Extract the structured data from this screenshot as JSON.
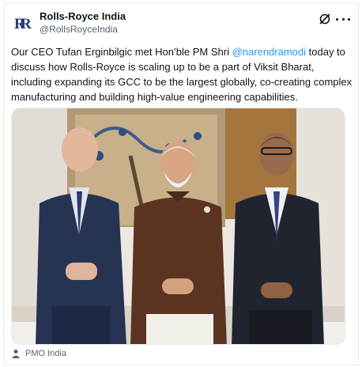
{
  "account": {
    "name": "Rolls-Royce India",
    "handle": "@RollsRoyceIndia"
  },
  "tweet": {
    "text_before": "Our CEO Tufan Erginbilgic met Hon’ble PM Shri ",
    "mention": "@narendramodi",
    "text_after": " today to discuss how Rolls-Royce is scaling up to be a part of Viksit Bharat, including expanding its GCC to be the largest globally, co-creating complex manufacturing and building high-value engineering capabilities."
  },
  "media": {
    "alt": "Photo of three men standing together in front of a painted wall"
  },
  "credit": {
    "label": "PMO India"
  },
  "colors": {
    "link": "#1d9bf0",
    "secondary_text": "#536471",
    "primary_text": "#0f1419"
  },
  "icons": {
    "avatar": "rolls-royce-logo",
    "grok": "grok-icon",
    "more": "more-icon",
    "credit": "person-icon"
  }
}
